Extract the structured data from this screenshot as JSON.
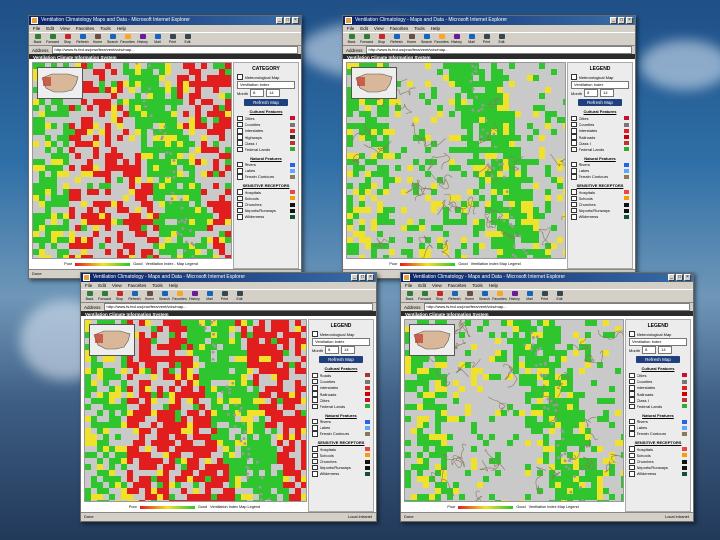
{
  "windows": [
    {
      "id": "w1",
      "title": "Ventilation Climatology Maps and Data - Microsoft Internet Explorer",
      "menu": [
        "File",
        "Edit",
        "View",
        "Favorites",
        "Tools",
        "Help"
      ],
      "toolbar": [
        "Back",
        "Forward",
        "Stop",
        "Refresh",
        "Home",
        "Search",
        "Favorites",
        "History",
        "Mail",
        "Print",
        "Edit"
      ],
      "address_label": "Address",
      "address": "http://www.fs.fed.us/pnw/fera/vent/vcis/map...",
      "app_title": "Ventilation Climate Information System",
      "panel": {
        "heading": "CATEGORY",
        "map_type_label": "Meteorological Map",
        "map_type_value": "Ventilation Index",
        "month_label": "Month",
        "month_value": "8",
        "hour_value": "14",
        "button": "Refresh Map",
        "cultural_heading": "Cultural Features",
        "cultural": [
          "Cities",
          "Counties",
          "Interstates",
          "Highways",
          "Class I",
          "Federal Lands"
        ],
        "natural_heading": "Natural Features",
        "natural": [
          "Rivers",
          "Lakes",
          "Terrain Contours"
        ],
        "sensitive_heading": "SENSITIVE RECEPTORS",
        "sensitive": [
          "Hospitals",
          "Schools",
          "Churches",
          "Airports/Runways",
          "Wilderness"
        ]
      },
      "legend": {
        "low": "Poor",
        "high": "Good",
        "title": "Ventilation Index - Map Legend"
      },
      "status": "Done",
      "zone": "Local intranet"
    },
    {
      "id": "w2",
      "title": "Ventilation Climatology - Maps and Data - Microsoft Internet Explorer",
      "menu": [
        "File",
        "Edit",
        "View",
        "Favorites",
        "Tools",
        "Help"
      ],
      "toolbar": [
        "Back",
        "Forward",
        "Stop",
        "Refresh",
        "Home",
        "Search",
        "Favorites",
        "History",
        "Mail",
        "Print",
        "Edit"
      ],
      "address_label": "Address",
      "address": "http://www.fs.fed.us/pnw/fera/vent/vcis/map...",
      "app_title": "Ventilation Climate Information System",
      "panel": {
        "heading": "LEGEND",
        "map_type_label": "Meteorological Map",
        "map_type_value": "Ventilation Index",
        "month_label": "Month",
        "month_value": "8",
        "hour_value": "14",
        "button": "Refresh Map",
        "cultural_heading": "Cultural Features",
        "cultural": [
          "Cities",
          "Counties",
          "Interstates",
          "Railroads",
          "Class I",
          "Federal Lands"
        ],
        "natural_heading": "Natural Features",
        "natural": [
          "Rivers",
          "Lakes",
          "Terrain Contours"
        ],
        "sensitive_heading": "SENSITIVE RECEPTORS",
        "sensitive": [
          "Hospitals",
          "Schools",
          "Churches",
          "Airports/Runways",
          "Wilderness"
        ]
      },
      "legend": {
        "low": "Poor",
        "high": "Good",
        "title": "Ventilation Index Map Legend"
      },
      "status": "Done",
      "zone": "Local intranet"
    },
    {
      "id": "w3",
      "title": "Ventilation Climatology - Maps and Data - Microsoft Internet Explorer",
      "menu": [
        "File",
        "Edit",
        "View",
        "Favorites",
        "Tools",
        "Help"
      ],
      "toolbar": [
        "Back",
        "Forward",
        "Stop",
        "Refresh",
        "Home",
        "Search",
        "Favorites",
        "History",
        "Mail",
        "Print",
        "Edit"
      ],
      "address_label": "Address",
      "address": "http://www.fs.fed.us/pnw/fera/vent/vcis/map...",
      "app_title": "Ventilation Climate Information System",
      "panel": {
        "heading": "LEGEND",
        "map_type_label": "Meteorological Map",
        "map_type_value": "Ventilation Index",
        "month_label": "Month",
        "month_value": "8",
        "hour_value": "14",
        "button": "Refresh Map",
        "cultural_heading": "Cultural Features",
        "cultural": [
          "Roads",
          "Counties",
          "Interstates",
          "Railroads",
          "Cities",
          "Federal Lands"
        ],
        "natural_heading": "Natural Features",
        "natural": [
          "Rivers",
          "Lakes",
          "Terrain Contours"
        ],
        "sensitive_heading": "SENSITIVE RECEPTORS",
        "sensitive": [
          "Hospitals",
          "Schools",
          "Churches",
          "Airports/Runways",
          "Wilderness"
        ]
      },
      "legend": {
        "low": "Poor",
        "high": "Good",
        "title": "Ventilation Index Map Legend"
      },
      "status": "Done",
      "zone": "Local intranet"
    },
    {
      "id": "w4",
      "title": "Ventilation Climatology - Maps and Data - Microsoft Internet Explorer",
      "menu": [
        "File",
        "Edit",
        "View",
        "Favorites",
        "Tools",
        "Help"
      ],
      "toolbar": [
        "Back",
        "Forward",
        "Stop",
        "Refresh",
        "Home",
        "Search",
        "Favorites",
        "History",
        "Mail",
        "Print",
        "Edit"
      ],
      "address_label": "Address",
      "address": "http://www.fs.fed.us/pnw/fera/vent/vcis/map...",
      "app_title": "Ventilation Climate Information System",
      "panel": {
        "heading": "LEGEND",
        "map_type_label": "Meteorological Map",
        "map_type_value": "Ventilation Index",
        "month_label": "Month",
        "month_value": "8",
        "hour_value": "14",
        "button": "Refresh Map",
        "cultural_heading": "Cultural Features",
        "cultural": [
          "Cities",
          "Counties",
          "Interstates",
          "Railroads",
          "Class I",
          "Federal Lands"
        ],
        "natural_heading": "Natural Features",
        "natural": [
          "Rivers",
          "Lakes",
          "Terrain Contours"
        ],
        "sensitive_heading": "SENSITIVE RECEPTORS",
        "sensitive": [
          "Hospitals",
          "Schools",
          "Churches",
          "Airports/Runways",
          "Wilderness"
        ]
      },
      "legend": {
        "low": "Poor",
        "high": "Good",
        "title": "Ventilation Index Map Legend"
      },
      "status": "Done",
      "zone": "Local intranet"
    }
  ],
  "colors": {
    "poor": "#e11d1d",
    "fair": "#f0e22a",
    "good": "#2fc52f",
    "nodata": "#c9c9c9",
    "contour": "#8a7a5a"
  }
}
